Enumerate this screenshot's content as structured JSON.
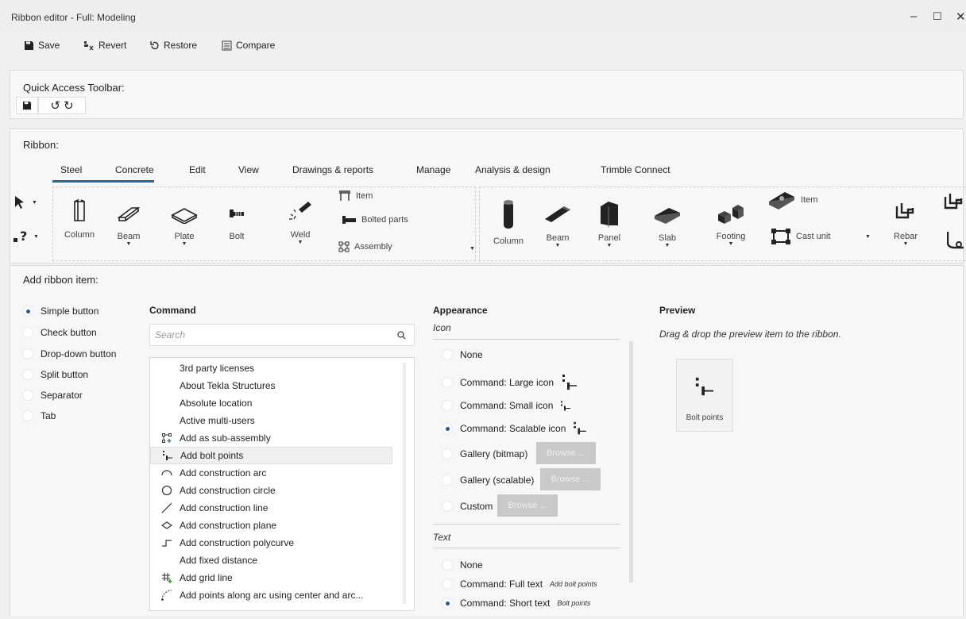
{
  "window": {
    "title": "Ribbon editor - Full: Modeling",
    "minimize": "–",
    "maximize": "☐",
    "close": "✕"
  },
  "toolbar": {
    "save": "Save",
    "revert": "Revert",
    "restore": "Restore",
    "compare": "Compare"
  },
  "qat": {
    "title": "Quick Access Toolbar:",
    "undo": "↺",
    "redo": "↻"
  },
  "ribbon": {
    "title": "Ribbon:",
    "tabs": [
      "Steel",
      "Concrete",
      "Edit",
      "View",
      "Drawings & reports",
      "Manage",
      "Analysis & design",
      "Trimble Connect"
    ],
    "select_glyph": "?",
    "steel_items": [
      "Column",
      "Beam",
      "Plate",
      "Bolt",
      "Weld"
    ],
    "steel_small": [
      "Item",
      "Bolted parts",
      "Assembly"
    ],
    "concrete_items": [
      "Column",
      "Beam",
      "Panel",
      "Slab",
      "Footing"
    ],
    "concrete_small": [
      "Item",
      "Cast unit"
    ],
    "rebar": "Rebar"
  },
  "add": {
    "title": "Add ribbon item:",
    "types": [
      "Simple button",
      "Check button",
      "Drop-down button",
      "Split button",
      "Separator",
      "Tab"
    ],
    "selected_type": 0,
    "command_header": "Command",
    "search_placeholder": "Search",
    "commands": [
      {
        "label": "3rd party licenses",
        "icon": "none"
      },
      {
        "label": "About Tekla Structures",
        "icon": "none"
      },
      {
        "label": "Absolute location",
        "icon": "none"
      },
      {
        "label": "Active multi-users",
        "icon": "none"
      },
      {
        "label": "Add as sub-assembly",
        "icon": "sub-assembly-icon"
      },
      {
        "label": "Add bolt points",
        "icon": "bolt-points-icon"
      },
      {
        "label": "Add construction arc",
        "icon": "arc-icon"
      },
      {
        "label": "Add construction circle",
        "icon": "circle-icon"
      },
      {
        "label": "Add construction line",
        "icon": "line-icon"
      },
      {
        "label": "Add construction plane",
        "icon": "plane-icon"
      },
      {
        "label": "Add construction polycurve",
        "icon": "polycurve-icon"
      },
      {
        "label": "Add fixed distance",
        "icon": "none"
      },
      {
        "label": "Add grid line",
        "icon": "grid-icon"
      },
      {
        "label": "Add points along arc using center and arc...",
        "icon": "points-arc-icon"
      }
    ],
    "selected_command": 5
  },
  "appearance": {
    "header": "Appearance",
    "icon_section": "Icon",
    "icon_options": [
      "None",
      "Command: Large icon",
      "Command: Small icon",
      "Command: Scalable icon",
      "Gallery (bitmap)",
      "Gallery (scalable)",
      "Custom"
    ],
    "icon_selected": 3,
    "browse": "Browse ...",
    "text_section": "Text",
    "text_options": [
      "None",
      "Command: Full text",
      "Command: Short text"
    ],
    "text_selected": 2,
    "full_text_note": "Add bolt points",
    "short_text_note": "Bolt points"
  },
  "preview": {
    "header": "Preview",
    "caption": "Drag & drop the preview item to the ribbon.",
    "item_label": "Bolt points"
  }
}
